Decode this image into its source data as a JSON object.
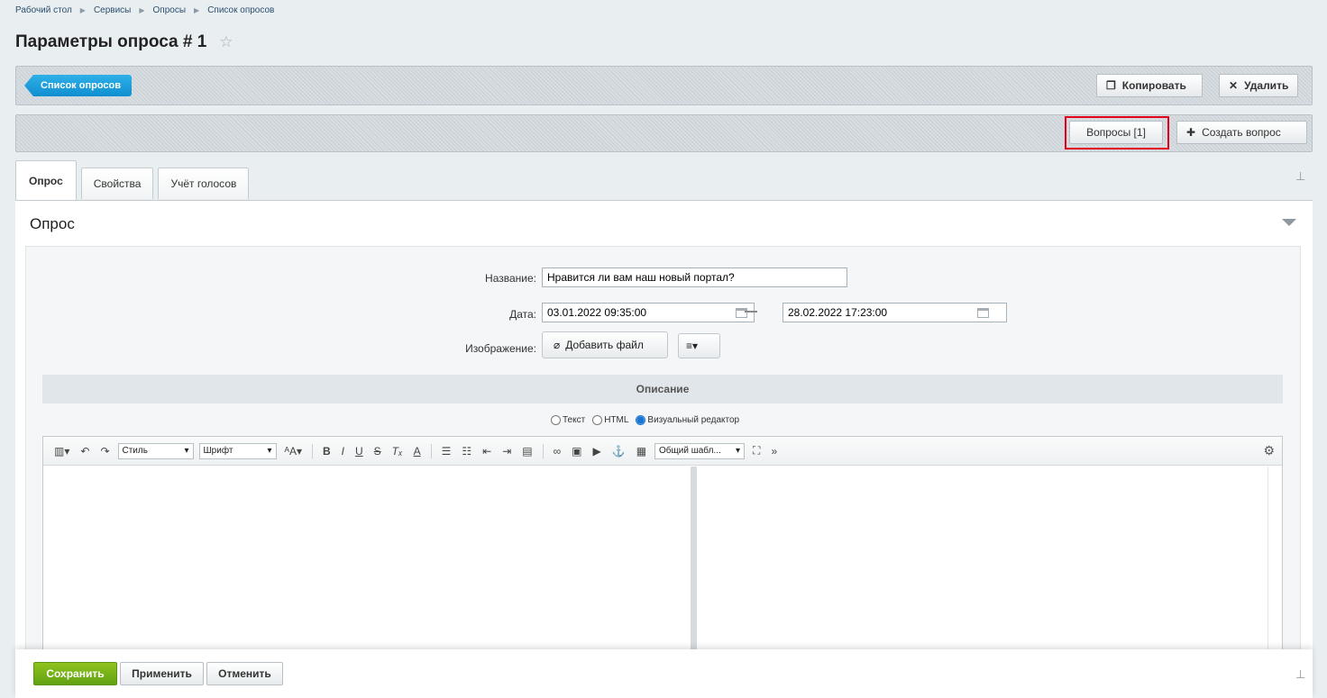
{
  "breadcrumb": [
    "Рабочий стол",
    "Сервисы",
    "Опросы",
    "Список опросов"
  ],
  "page": {
    "title": "Параметры опроса # 1"
  },
  "toolbar_top": {
    "list_button": "Список опросов",
    "copy_button": "Копировать",
    "delete_button": "Удалить"
  },
  "toolbar_mid": {
    "questions_button": "Вопросы [1]",
    "create_question_button": "Создать вопрос"
  },
  "tabs": [
    {
      "label": "Опрос",
      "active": true
    },
    {
      "label": "Свойства",
      "active": false
    },
    {
      "label": "Учёт голосов",
      "active": false
    }
  ],
  "section": {
    "title": "Опрос"
  },
  "form": {
    "name_label": "Название:",
    "name_value": "Нравится ли вам наш новый портал?",
    "date_label": "Дата:",
    "date_from": "03.01.2022 09:35:00",
    "date_to": "28.02.2022 17:23:00",
    "image_label": "Изображение:",
    "add_file_button": "Добавить файл"
  },
  "description": {
    "title": "Описание",
    "modes": [
      {
        "label": "Текст",
        "selected": false
      },
      {
        "label": "HTML",
        "selected": false
      },
      {
        "label": "Визуальный редактор",
        "selected": true
      }
    ]
  },
  "editor": {
    "style_select": "Стиль",
    "font_select": "Шрифт",
    "template_select": "Общий шабл..."
  },
  "footer": {
    "save_button": "Сохранить",
    "apply_button": "Применить",
    "cancel_button": "Отменить"
  },
  "colors": {
    "accent_blue": "#1a9fdc",
    "save_green": "#7ab51d",
    "highlight_red": "#e2001a"
  }
}
